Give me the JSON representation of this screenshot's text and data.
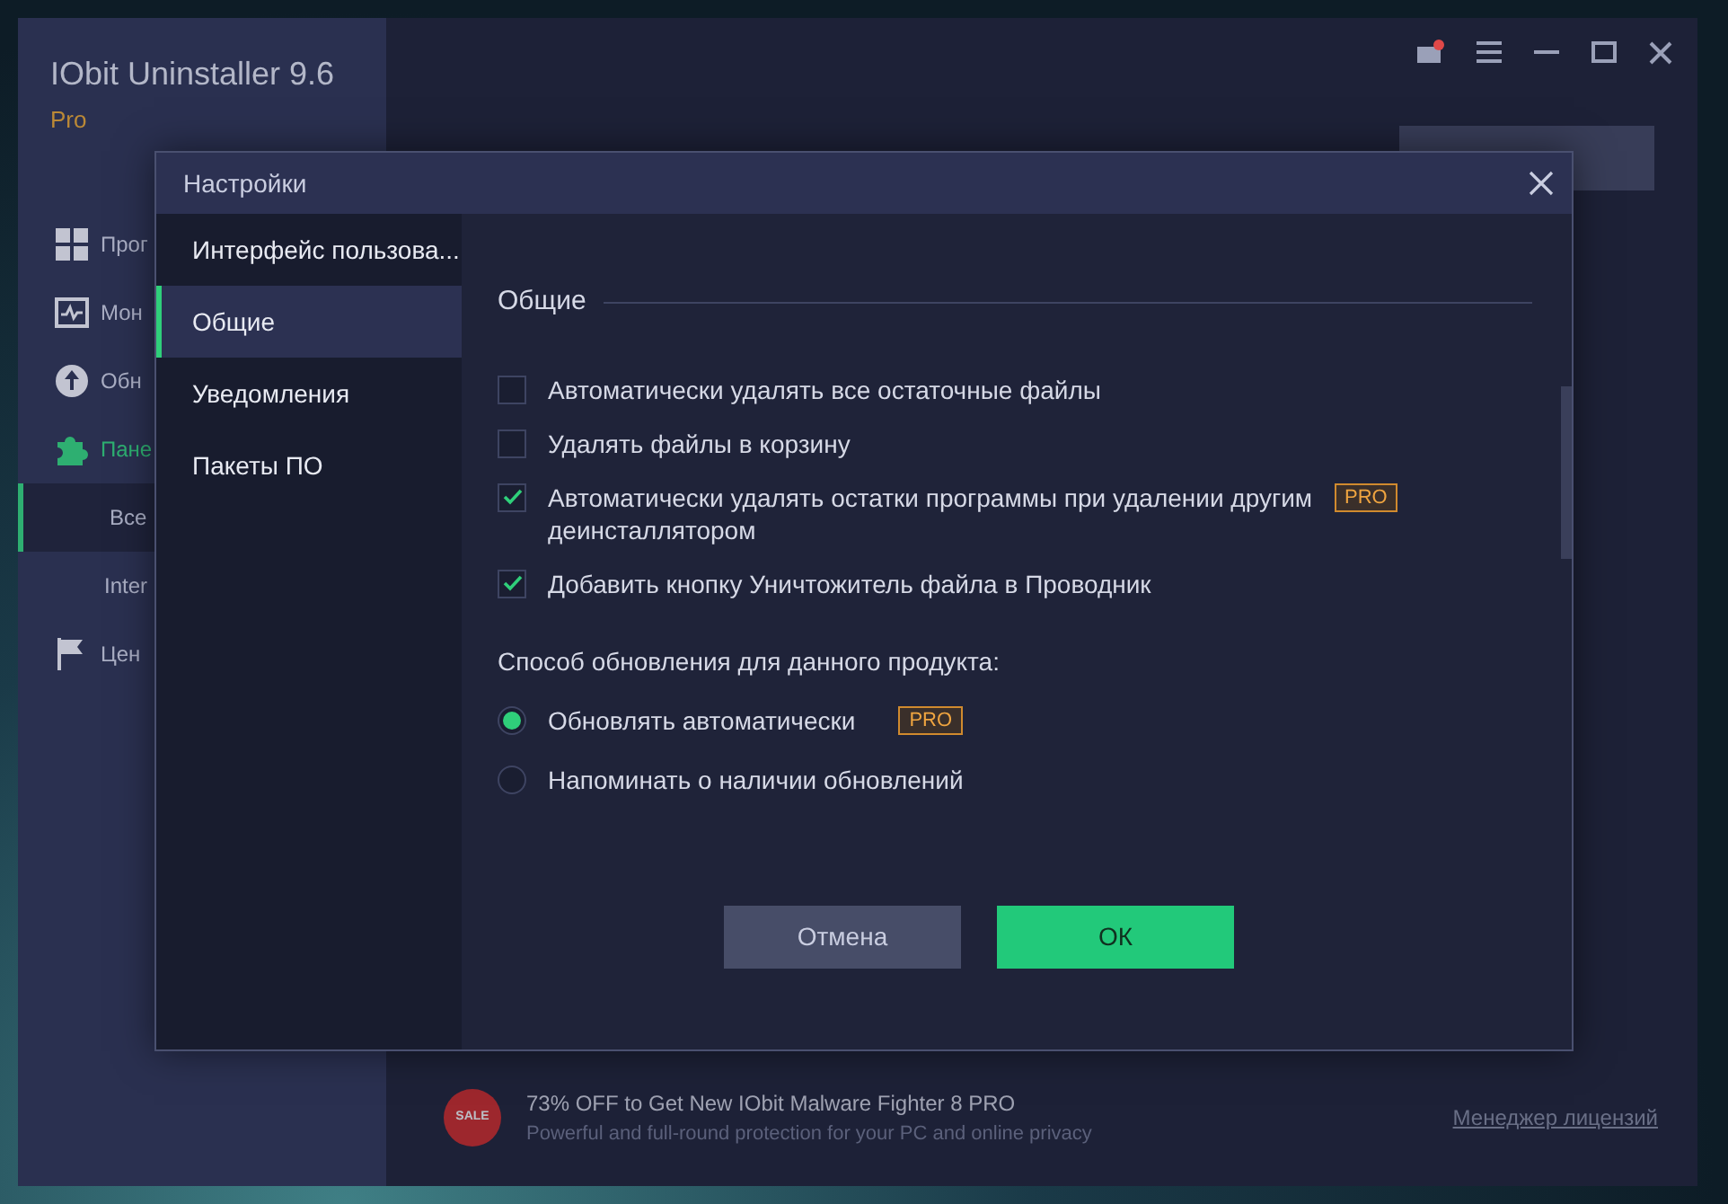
{
  "app": {
    "title": "IObit Uninstaller 9.6",
    "edition": "Pro",
    "nav": [
      {
        "label": "Прог",
        "kind": "main",
        "highlighted": false,
        "selected": false
      },
      {
        "label": "Мон",
        "kind": "main",
        "highlighted": false,
        "selected": false
      },
      {
        "label": "Обн",
        "kind": "main",
        "highlighted": false,
        "selected": false
      },
      {
        "label": "Пане",
        "kind": "main",
        "highlighted": true,
        "selected": false
      },
      {
        "label": "Все",
        "kind": "sub",
        "highlighted": false,
        "selected": true
      },
      {
        "label": "Inter",
        "kind": "sub",
        "highlighted": false,
        "selected": false
      },
      {
        "label": "Цен",
        "kind": "main",
        "highlighted": false,
        "selected": false
      }
    ]
  },
  "banner": {
    "badge": "SALE",
    "headline": "73% OFF to Get New IObit Malware Fighter 8 PRO",
    "subline": "Powerful and full-round protection for your PC and online privacy",
    "link": "Менеджер лицензий"
  },
  "dialog": {
    "title": "Настройки",
    "nav": [
      {
        "label": "Интерфейс пользова...",
        "selected": false
      },
      {
        "label": "Общие",
        "selected": true
      },
      {
        "label": "Уведомления",
        "selected": false
      },
      {
        "label": "Пакеты ПО",
        "selected": false
      }
    ],
    "section_title": "Общие",
    "options": [
      {
        "label": "Автоматически удалять все остаточные файлы",
        "checked": false
      },
      {
        "label": "Удалять файлы в корзину",
        "checked": false
      },
      {
        "label": "Автоматически удалять остатки программы при удалении другим",
        "label_2": "деинсталлятором",
        "checked": true,
        "badge": "PRO"
      },
      {
        "label": "Добавить кнопку Уничтожитель файла в Проводник",
        "checked": true
      }
    ],
    "update_label": "Способ обновления для данного продукта:",
    "update_options": [
      {
        "label": "Обновлять автоматически",
        "selected": true,
        "badge": "PRO"
      },
      {
        "label": "Напоминать о наличии обновлений",
        "selected": false
      }
    ],
    "buttons": [
      {
        "label": "Отмена",
        "kind": "secondary"
      },
      {
        "label": "ОК",
        "kind": "primary"
      }
    ]
  }
}
